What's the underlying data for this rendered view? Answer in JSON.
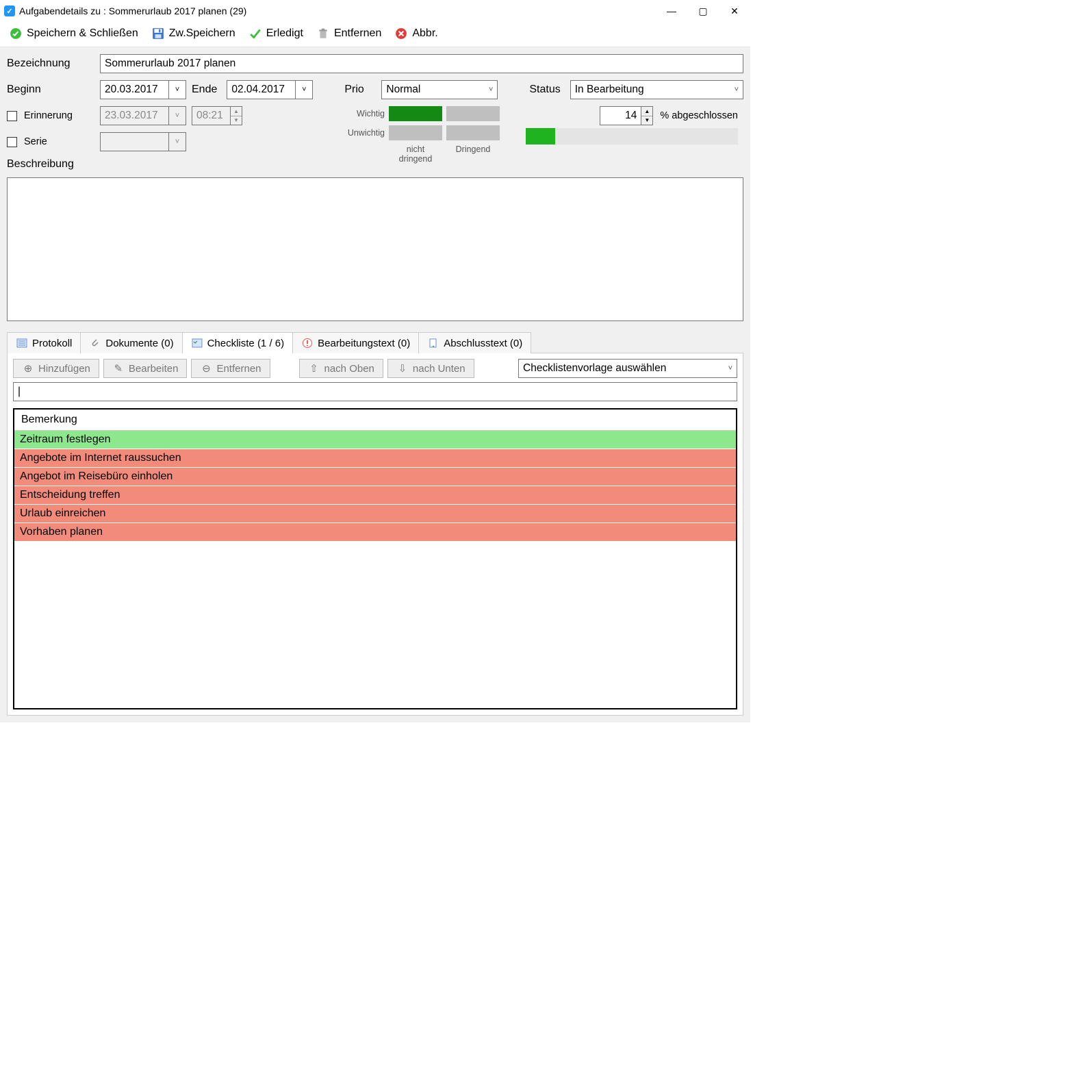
{
  "window": {
    "title": "Aufgabendetails zu : Sommerurlaub 2017 planen (29)"
  },
  "toolbar": {
    "save_close": "Speichern & Schließen",
    "save": "Zw.Speichern",
    "done": "Erledigt",
    "remove": "Entfernen",
    "cancel": "Abbr."
  },
  "form": {
    "bezeichnung_label": "Bezeichnung",
    "bezeichnung_value": "Sommerurlaub 2017 planen",
    "beginn_label": "Beginn",
    "beginn_value": "20.03.2017",
    "ende_label": "Ende",
    "ende_value": "02.04.2017",
    "prio_label": "Prio",
    "prio_value": "Normal",
    "status_label": "Status",
    "status_value": "In Bearbeitung",
    "erinnerung_label": "Erinnerung",
    "erinnerung_date": "23.03.2017",
    "erinnerung_time": "08:21",
    "serie_label": "Serie",
    "matrix": {
      "row1": "Wichtig",
      "row2": "Unwichtig",
      "col1": "nicht dringend",
      "col2": "Dringend"
    },
    "percent_value": "14",
    "percent_label": "% abgeschlossen",
    "beschreibung_label": "Beschreibung"
  },
  "tabs": {
    "protokoll": "Protokoll",
    "dokumente": "Dokumente (0)",
    "checkliste": "Checkliste (1 / 6)",
    "bearbeitungstext": "Bearbeitungstext (0)",
    "abschlusstext": "Abschlusstext (0)"
  },
  "checklist_toolbar": {
    "add": "Hinzufügen",
    "edit": "Bearbeiten",
    "remove": "Entfernen",
    "up": "nach Oben",
    "down": "nach Unten",
    "template": "Checklistenvorlage auswählen"
  },
  "checklist": {
    "header": "Bemerkung",
    "rows": [
      {
        "text": "Zeitraum festlegen",
        "done": true
      },
      {
        "text": "Angebote im Internet raussuchen",
        "done": false
      },
      {
        "text": "Angebot im Reisebüro einholen",
        "done": false
      },
      {
        "text": "Entscheidung treffen",
        "done": false
      },
      {
        "text": "Urlaub einreichen",
        "done": false
      },
      {
        "text": "Vorhaben planen",
        "done": false
      }
    ]
  }
}
